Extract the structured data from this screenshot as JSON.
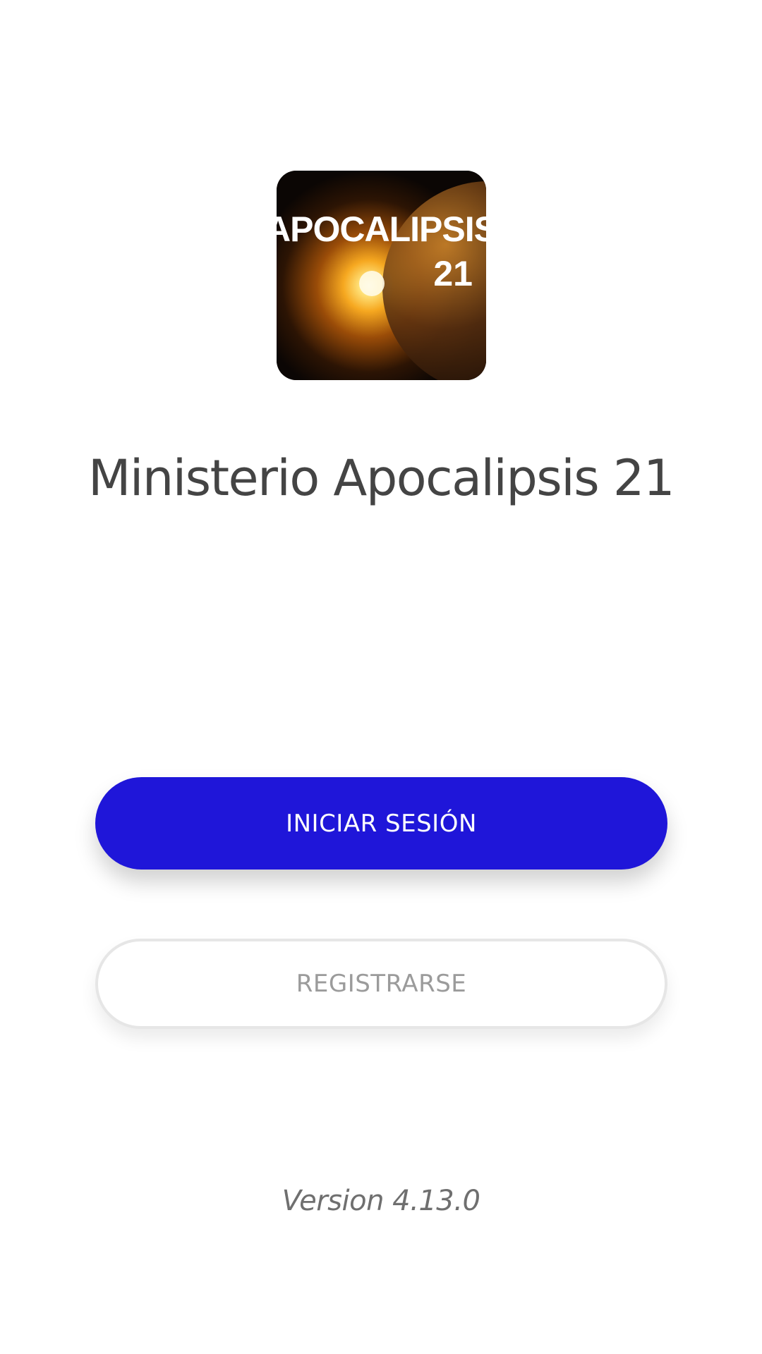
{
  "logo": {
    "line1": "APOCALIPSIS",
    "line2": "21"
  },
  "app_title": "Ministerio Apocalipsis 21",
  "buttons": {
    "login_label": "INICIAR SESIÓN",
    "register_label": "REGISTRARSE"
  },
  "version": "Version 4.13.0",
  "colors": {
    "primary": "#1f16d9",
    "title_text": "#444444",
    "secondary_text": "#9b9b9b"
  }
}
